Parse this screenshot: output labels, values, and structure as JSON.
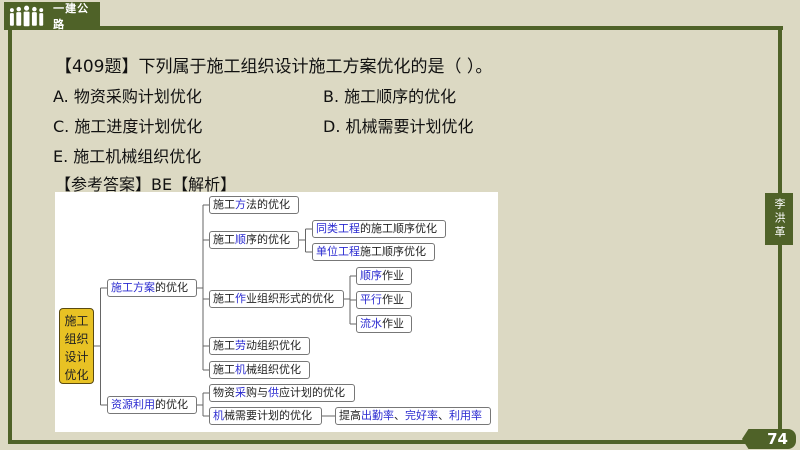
{
  "header": {
    "tab_label": "一建公路",
    "author": "李洪革",
    "page_number": "74"
  },
  "question": {
    "title": "【409题】下列属于施工组织设计施工方案优化的是（    ）。",
    "options": [
      "A. 物资采购计划优化",
      "B. 施工顺序的优化",
      "C. 施工进度计划优化",
      "D. 机械需要计划优化",
      "E. 施工机械组织优化"
    ],
    "answer": "【参考答案】BE【解析】"
  },
  "mindmap": {
    "root": "施工组织设计优化",
    "nodes": [
      {
        "id": "n1",
        "parent": "root",
        "parts": [
          {
            "t": "施工方案",
            "b": true
          },
          {
            "t": "的优化",
            "b": false
          }
        ]
      },
      {
        "id": "n2",
        "parent": "root",
        "parts": [
          {
            "t": "资源利用",
            "b": true
          },
          {
            "t": "的优化",
            "b": false
          }
        ]
      },
      {
        "id": "n11",
        "parent": "n1",
        "parts": [
          {
            "t": "施工",
            "b": false
          },
          {
            "t": "方",
            "b": true
          },
          {
            "t": "法的优化",
            "b": false
          }
        ]
      },
      {
        "id": "n12",
        "parent": "n1",
        "parts": [
          {
            "t": "施工",
            "b": false
          },
          {
            "t": "顺",
            "b": true
          },
          {
            "t": "序的优化",
            "b": false
          }
        ]
      },
      {
        "id": "n13",
        "parent": "n1",
        "parts": [
          {
            "t": "施工",
            "b": false
          },
          {
            "t": "作",
            "b": true
          },
          {
            "t": "业组织形式的优化",
            "b": false
          }
        ]
      },
      {
        "id": "n14",
        "parent": "n1",
        "parts": [
          {
            "t": "施工",
            "b": false
          },
          {
            "t": "劳",
            "b": true
          },
          {
            "t": "动组织优化",
            "b": false
          }
        ]
      },
      {
        "id": "n15",
        "parent": "n1",
        "parts": [
          {
            "t": "施工",
            "b": false
          },
          {
            "t": "机",
            "b": true
          },
          {
            "t": "械组织优化",
            "b": false
          }
        ]
      },
      {
        "id": "n121",
        "parent": "n12",
        "parts": [
          {
            "t": "同类工程",
            "b": true
          },
          {
            "t": "的施工顺序优化",
            "b": false
          }
        ]
      },
      {
        "id": "n122",
        "parent": "n12",
        "parts": [
          {
            "t": "单位工程",
            "b": true
          },
          {
            "t": "施工顺序优化",
            "b": false
          }
        ]
      },
      {
        "id": "n131",
        "parent": "n13",
        "parts": [
          {
            "t": "顺序",
            "b": true
          },
          {
            "t": "作业",
            "b": false
          }
        ]
      },
      {
        "id": "n132",
        "parent": "n13",
        "parts": [
          {
            "t": "平行",
            "b": true
          },
          {
            "t": "作业",
            "b": false
          }
        ]
      },
      {
        "id": "n133",
        "parent": "n13",
        "parts": [
          {
            "t": "流水",
            "b": true
          },
          {
            "t": "作业",
            "b": false
          }
        ]
      },
      {
        "id": "n21",
        "parent": "n2",
        "parts": [
          {
            "t": "物资",
            "b": false
          },
          {
            "t": "采",
            "b": true
          },
          {
            "t": "购与",
            "b": false
          },
          {
            "t": "供",
            "b": true
          },
          {
            "t": "应计划的优化",
            "b": false
          }
        ]
      },
      {
        "id": "n22",
        "parent": "n2",
        "parts": [
          {
            "t": "机",
            "b": true
          },
          {
            "t": "械需要计划的优化",
            "b": false
          }
        ]
      },
      {
        "id": "n221",
        "parent": "n22",
        "parts": [
          {
            "t": "提高",
            "b": false
          },
          {
            "t": "出勤率",
            "b": true
          },
          {
            "t": "、",
            "b": false
          },
          {
            "t": "完好率",
            "b": true
          },
          {
            "t": "、",
            "b": false
          },
          {
            "t": "利用率",
            "b": true
          }
        ]
      }
    ]
  }
}
